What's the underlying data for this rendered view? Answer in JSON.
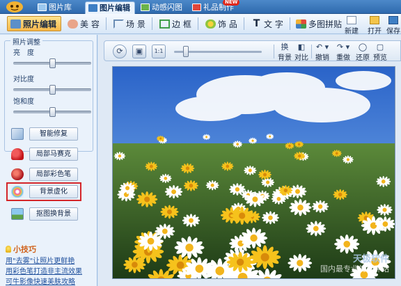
{
  "tabs": [
    {
      "label": "图片库",
      "icon": "photo-library-icon"
    },
    {
      "label": "图片编辑",
      "icon": "photo-edit-icon",
      "active": true
    },
    {
      "label": "动感闪图",
      "icon": "flash-image-icon"
    },
    {
      "label": "礼品制作",
      "icon": "gift-icon"
    }
  ],
  "tab_badge": "NEW",
  "toolbar": {
    "tools": [
      {
        "label": "照片编辑",
        "icon": "photo-edit-icon",
        "active": true
      },
      {
        "label": "美 容",
        "icon": "face-beauty-icon"
      },
      {
        "label": "场 景",
        "icon": "scene-icon"
      },
      {
        "label": "边 框",
        "icon": "frame-icon"
      },
      {
        "label": "饰 品",
        "icon": "accessory-icon"
      },
      {
        "label": "文 字",
        "icon": "text-icon"
      },
      {
        "label": "多图拼贴",
        "icon": "collage-icon"
      }
    ],
    "file_buttons": [
      {
        "label": "新建",
        "icon": "new-file-icon"
      },
      {
        "label": "打开",
        "icon": "open-folder-icon"
      },
      {
        "label": "保存",
        "icon": "save-icon"
      }
    ]
  },
  "adjust": {
    "title": "照片调整",
    "brightness": {
      "label": "亮　度",
      "value": 0.5
    },
    "contrast": {
      "label": "对比度",
      "value": 0.5
    },
    "saturation": {
      "label": "饱和度",
      "value": 0.5
    }
  },
  "effects": [
    {
      "label": "智能修复",
      "icon": "smart-repair-icon"
    },
    {
      "label": "局部马赛克",
      "icon": "mosaic-icon"
    },
    {
      "label": "局部彩色笔",
      "icon": "color-pen-icon"
    },
    {
      "label": "背景虚化",
      "icon": "background-blur-icon",
      "selected": true
    },
    {
      "label": "抠图换背景",
      "icon": "cutout-background-icon"
    }
  ],
  "tips": {
    "title": "小技巧",
    "items": [
      "用\"去雾\"让照片更鲜艳",
      "用彩色笔打造非主流效果",
      "可牛影像快速美肤攻略"
    ]
  },
  "viewbar": {
    "zoom_value": 0.1,
    "tools": [
      {
        "label": "换背景",
        "label_top": "换",
        "label_bottom": "背景",
        "icon": "change-background-icon"
      },
      {
        "label": "对比",
        "icon": "compare-icon"
      },
      {
        "label": "撤销",
        "icon": "undo-icon"
      },
      {
        "label": "重做",
        "icon": "redo-icon"
      },
      {
        "label": "还原",
        "icon": "restore-icon"
      },
      {
        "label": "预览",
        "icon": "preview-icon"
      }
    ]
  },
  "watermark": {
    "line1": "天极软件",
    "line2": "国内最专业的软件站"
  },
  "colors": {
    "tab_bar": "#2f6aae",
    "active_tool": "#f7b84a",
    "selected_border": "#d4262a",
    "tip_title": "#d0611b",
    "tip_link": "#1e4f9c"
  }
}
